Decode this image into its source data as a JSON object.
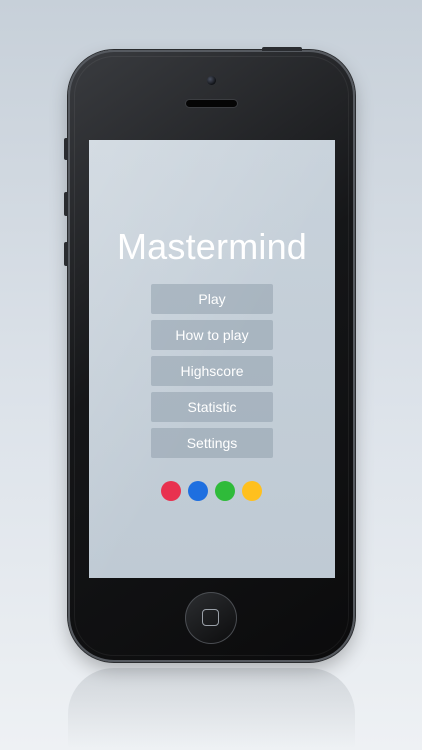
{
  "app": {
    "title": "Mastermind"
  },
  "menu": [
    {
      "label": "Play"
    },
    {
      "label": "How to play"
    },
    {
      "label": "Highscore"
    },
    {
      "label": "Statistic"
    },
    {
      "label": "Settings"
    }
  ],
  "color_pegs": [
    {
      "name": "red",
      "color": "#e8314f"
    },
    {
      "name": "blue",
      "color": "#1e6fe0"
    },
    {
      "name": "green",
      "color": "#2fbb3a"
    },
    {
      "name": "yellow",
      "color": "#ffc01e"
    }
  ],
  "device": {
    "home_icon": "home-button-icon",
    "camera_icon": "front-camera-icon"
  }
}
